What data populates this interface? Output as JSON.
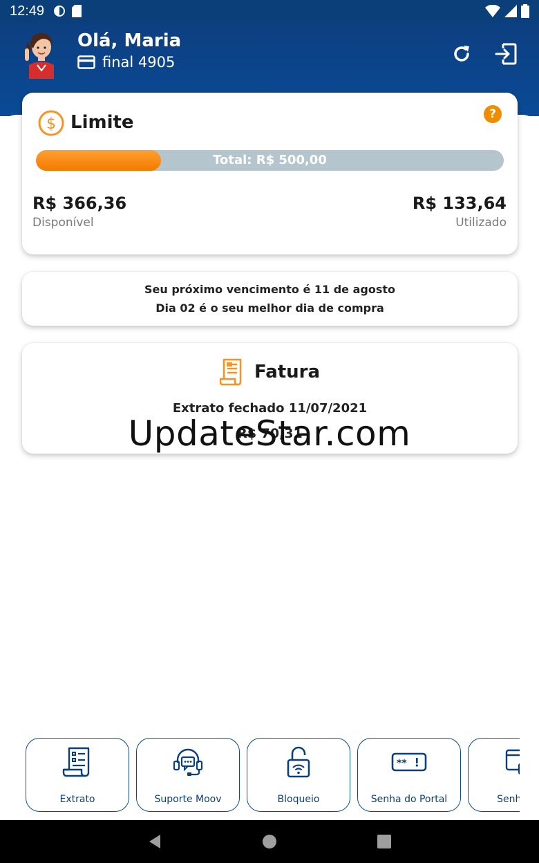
{
  "status_bar": {
    "time": "12:49"
  },
  "header": {
    "greeting": "Olá, Maria",
    "card_label": "final 4905"
  },
  "limit": {
    "title": "Limite",
    "total_label": "Total: R$ 500,00",
    "used_fraction": 0.2673,
    "available_amount": "R$ 366,36",
    "available_label": "Disponível",
    "used_amount": "R$ 133,64",
    "used_label": "Utilizado"
  },
  "due": {
    "line1": "Seu próximo vencimento é 11 de agosto",
    "line2": "Dia 02 é o seu melhor dia de compra"
  },
  "invoice": {
    "title": "Fatura",
    "closed_text": "Extrato fechado 11/07/2021",
    "amount": "R$ 70,31"
  },
  "watermark": "UpdateStar.com",
  "shortcuts": [
    {
      "label": "Extrato",
      "icon": "receipt-list-icon"
    },
    {
      "label": "Suporte Moov",
      "icon": "headset-icon"
    },
    {
      "label": "Bloqueio",
      "icon": "unlock-wifi-icon"
    },
    {
      "label": "Senha do Portal",
      "icon": "password-field-icon"
    },
    {
      "label": "Senha de",
      "icon": "card-lock-icon"
    }
  ],
  "colors": {
    "header_blue": "#0a4a96",
    "accent_orange": "#f47a00",
    "progress_track": "#b4c5cd",
    "shortcut_border": "#0b4a8e"
  }
}
